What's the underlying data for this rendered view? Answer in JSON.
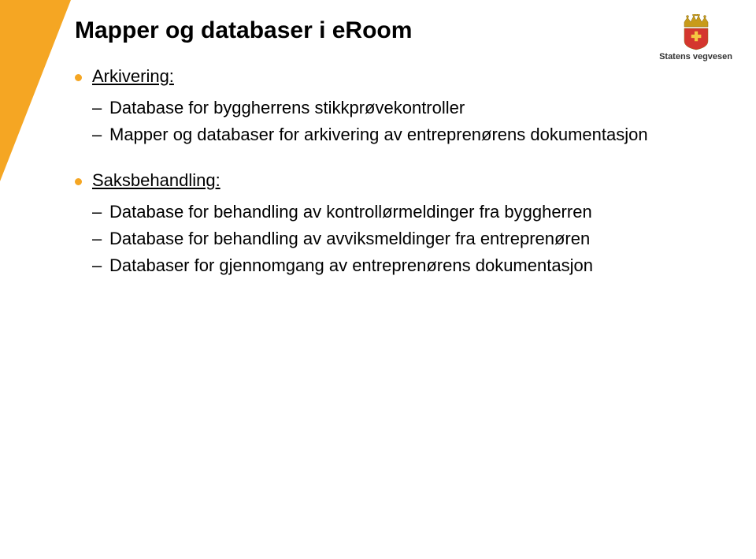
{
  "logo": {
    "text": "Statens vegvesen"
  },
  "slide": {
    "title": "Mapper og databaser i eRoom",
    "sections": [
      {
        "heading": "Arkivering:",
        "items": [
          "Database for byggherrens stikkprøvekontroller",
          "Mapper og databaser for arkivering av entreprenørens dokumentasjon"
        ]
      },
      {
        "heading": "Saksbehandling:",
        "items": [
          "Database for behandling av kontrollørmeldinger fra byggherren",
          "Database for behandling av avviksmeldinger fra entreprenøren",
          "Databaser for gjennomgang av entreprenørens dokumentasjon"
        ]
      }
    ]
  }
}
